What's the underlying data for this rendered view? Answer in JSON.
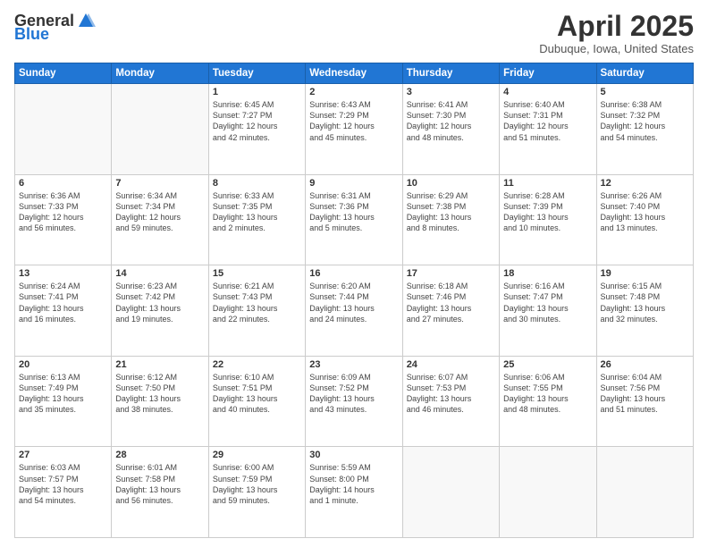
{
  "header": {
    "logo_general": "General",
    "logo_blue": "Blue",
    "title": "April 2025",
    "location": "Dubuque, Iowa, United States"
  },
  "days_of_week": [
    "Sunday",
    "Monday",
    "Tuesday",
    "Wednesday",
    "Thursday",
    "Friday",
    "Saturday"
  ],
  "weeks": [
    [
      {
        "day": "",
        "info": ""
      },
      {
        "day": "",
        "info": ""
      },
      {
        "day": "1",
        "info": "Sunrise: 6:45 AM\nSunset: 7:27 PM\nDaylight: 12 hours\nand 42 minutes."
      },
      {
        "day": "2",
        "info": "Sunrise: 6:43 AM\nSunset: 7:29 PM\nDaylight: 12 hours\nand 45 minutes."
      },
      {
        "day": "3",
        "info": "Sunrise: 6:41 AM\nSunset: 7:30 PM\nDaylight: 12 hours\nand 48 minutes."
      },
      {
        "day": "4",
        "info": "Sunrise: 6:40 AM\nSunset: 7:31 PM\nDaylight: 12 hours\nand 51 minutes."
      },
      {
        "day": "5",
        "info": "Sunrise: 6:38 AM\nSunset: 7:32 PM\nDaylight: 12 hours\nand 54 minutes."
      }
    ],
    [
      {
        "day": "6",
        "info": "Sunrise: 6:36 AM\nSunset: 7:33 PM\nDaylight: 12 hours\nand 56 minutes."
      },
      {
        "day": "7",
        "info": "Sunrise: 6:34 AM\nSunset: 7:34 PM\nDaylight: 12 hours\nand 59 minutes."
      },
      {
        "day": "8",
        "info": "Sunrise: 6:33 AM\nSunset: 7:35 PM\nDaylight: 13 hours\nand 2 minutes."
      },
      {
        "day": "9",
        "info": "Sunrise: 6:31 AM\nSunset: 7:36 PM\nDaylight: 13 hours\nand 5 minutes."
      },
      {
        "day": "10",
        "info": "Sunrise: 6:29 AM\nSunset: 7:38 PM\nDaylight: 13 hours\nand 8 minutes."
      },
      {
        "day": "11",
        "info": "Sunrise: 6:28 AM\nSunset: 7:39 PM\nDaylight: 13 hours\nand 10 minutes."
      },
      {
        "day": "12",
        "info": "Sunrise: 6:26 AM\nSunset: 7:40 PM\nDaylight: 13 hours\nand 13 minutes."
      }
    ],
    [
      {
        "day": "13",
        "info": "Sunrise: 6:24 AM\nSunset: 7:41 PM\nDaylight: 13 hours\nand 16 minutes."
      },
      {
        "day": "14",
        "info": "Sunrise: 6:23 AM\nSunset: 7:42 PM\nDaylight: 13 hours\nand 19 minutes."
      },
      {
        "day": "15",
        "info": "Sunrise: 6:21 AM\nSunset: 7:43 PM\nDaylight: 13 hours\nand 22 minutes."
      },
      {
        "day": "16",
        "info": "Sunrise: 6:20 AM\nSunset: 7:44 PM\nDaylight: 13 hours\nand 24 minutes."
      },
      {
        "day": "17",
        "info": "Sunrise: 6:18 AM\nSunset: 7:46 PM\nDaylight: 13 hours\nand 27 minutes."
      },
      {
        "day": "18",
        "info": "Sunrise: 6:16 AM\nSunset: 7:47 PM\nDaylight: 13 hours\nand 30 minutes."
      },
      {
        "day": "19",
        "info": "Sunrise: 6:15 AM\nSunset: 7:48 PM\nDaylight: 13 hours\nand 32 minutes."
      }
    ],
    [
      {
        "day": "20",
        "info": "Sunrise: 6:13 AM\nSunset: 7:49 PM\nDaylight: 13 hours\nand 35 minutes."
      },
      {
        "day": "21",
        "info": "Sunrise: 6:12 AM\nSunset: 7:50 PM\nDaylight: 13 hours\nand 38 minutes."
      },
      {
        "day": "22",
        "info": "Sunrise: 6:10 AM\nSunset: 7:51 PM\nDaylight: 13 hours\nand 40 minutes."
      },
      {
        "day": "23",
        "info": "Sunrise: 6:09 AM\nSunset: 7:52 PM\nDaylight: 13 hours\nand 43 minutes."
      },
      {
        "day": "24",
        "info": "Sunrise: 6:07 AM\nSunset: 7:53 PM\nDaylight: 13 hours\nand 46 minutes."
      },
      {
        "day": "25",
        "info": "Sunrise: 6:06 AM\nSunset: 7:55 PM\nDaylight: 13 hours\nand 48 minutes."
      },
      {
        "day": "26",
        "info": "Sunrise: 6:04 AM\nSunset: 7:56 PM\nDaylight: 13 hours\nand 51 minutes."
      }
    ],
    [
      {
        "day": "27",
        "info": "Sunrise: 6:03 AM\nSunset: 7:57 PM\nDaylight: 13 hours\nand 54 minutes."
      },
      {
        "day": "28",
        "info": "Sunrise: 6:01 AM\nSunset: 7:58 PM\nDaylight: 13 hours\nand 56 minutes."
      },
      {
        "day": "29",
        "info": "Sunrise: 6:00 AM\nSunset: 7:59 PM\nDaylight: 13 hours\nand 59 minutes."
      },
      {
        "day": "30",
        "info": "Sunrise: 5:59 AM\nSunset: 8:00 PM\nDaylight: 14 hours\nand 1 minute."
      },
      {
        "day": "",
        "info": ""
      },
      {
        "day": "",
        "info": ""
      },
      {
        "day": "",
        "info": ""
      }
    ]
  ]
}
